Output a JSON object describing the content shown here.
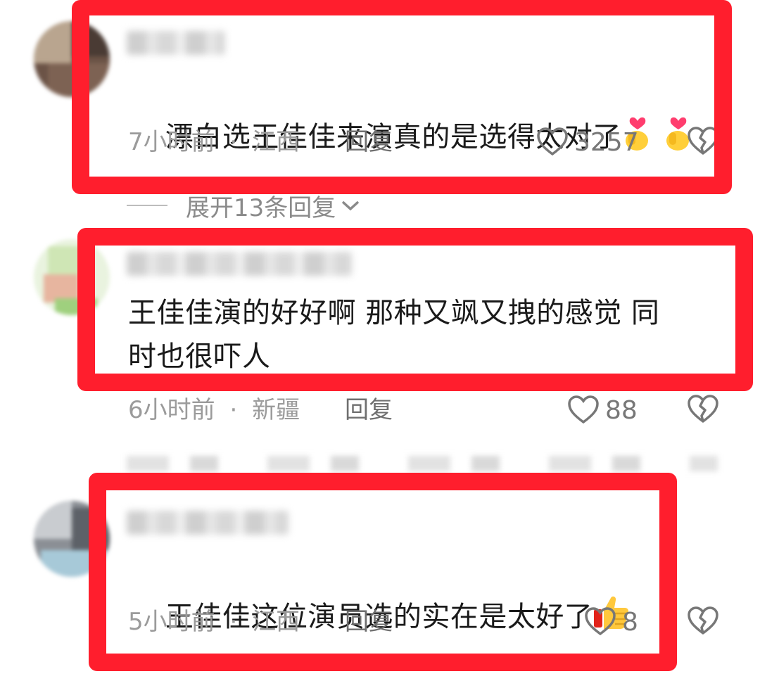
{
  "comments": [
    {
      "text": "漂白选王佳佳来演真的是选得太对了",
      "emoji": [
        "heart-hand-emoji",
        "heart-hand-emoji"
      ],
      "time": "7小时前",
      "location": "江西",
      "reply_label": "回复",
      "likes": "3257"
    },
    {
      "text": "王佳佳演的好好啊 那种又飒又拽的感觉 同\n时也很吓人",
      "time": "6小时前",
      "location": "新疆",
      "reply_label": "回复",
      "likes": "88"
    },
    {
      "text": "王佳佳这位演员选的实在是太好了",
      "emoji": [
        "thumbs-up-emoji"
      ],
      "time": "5小时前",
      "location": "江西",
      "reply_label": "回复",
      "likes": "8"
    }
  ],
  "expand_replies_label": "展开13条回复",
  "colors": {
    "highlight": "#ff1e2d",
    "meta": "#9b9b9b"
  },
  "separator": "·"
}
